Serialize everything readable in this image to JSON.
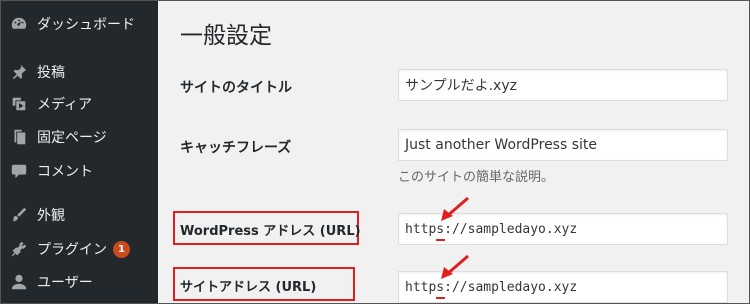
{
  "sidebar": {
    "items": [
      {
        "label": "ダッシュボード",
        "icon": "dashboard-icon"
      },
      {
        "label": "投稿",
        "icon": "pin-icon"
      },
      {
        "label": "メディア",
        "icon": "media-icon"
      },
      {
        "label": "固定ページ",
        "icon": "page-icon"
      },
      {
        "label": "コメント",
        "icon": "comment-icon"
      },
      {
        "label": "外観",
        "icon": "brush-icon"
      },
      {
        "label": "プラグイン",
        "icon": "plugin-icon",
        "badge": "1"
      },
      {
        "label": "ユーザー",
        "icon": "user-icon"
      }
    ]
  },
  "main": {
    "title": "一般設定",
    "fields": {
      "site_title": {
        "label": "サイトのタイトル",
        "value": "サンプルだよ.xyz"
      },
      "tagline": {
        "label": "キャッチフレーズ",
        "value": "Just another WordPress site",
        "description": "このサイトの簡単な説明。"
      },
      "wp_address": {
        "label": "WordPress アドレス (URL)",
        "value": "https://sampledayo.xyz"
      },
      "site_address": {
        "label": "サイトアドレス (URL)",
        "value": "https://sampledayo.xyz"
      }
    }
  },
  "colors": {
    "sidebar_bg": "#23282d",
    "badge": "#ca4a1f",
    "annotation_red": "#e02020"
  }
}
